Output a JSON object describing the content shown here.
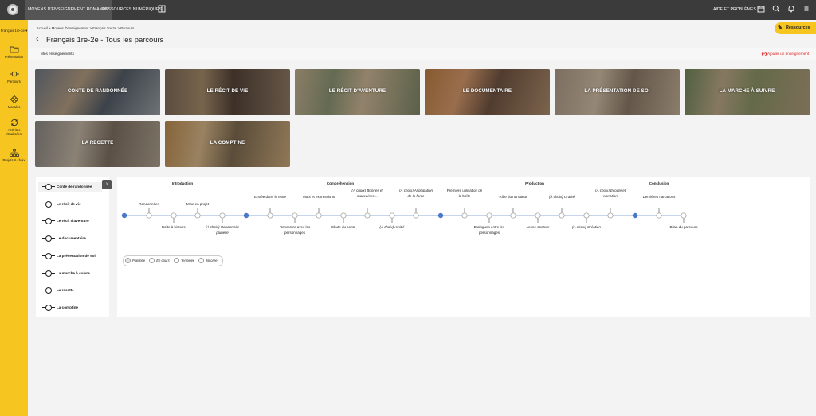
{
  "topbar": {
    "tab_moyens": "MOYENS D'ENSEIGNEMENT ROMANDS",
    "tab_ressources": "RESSOURCES NUMÉRIQUES",
    "help": "AIDE ET PROBLÈMES",
    "icons": [
      "book-icon",
      "calendar-icon",
      "search-icon",
      "bell-icon",
      "menu-icon"
    ]
  },
  "sidebar": {
    "class_selector": "Français 1re-2e",
    "items": [
      {
        "label": "Présentation",
        "icon": "folder-icon"
      },
      {
        "label": "Parcours",
        "icon": "path-icon"
      },
      {
        "label": "Modules",
        "icon": "modules-icon"
      },
      {
        "label": "Activités ritualisées",
        "icon": "cycle-icon"
      },
      {
        "label": "Projets & choix",
        "icon": "network-icon"
      }
    ]
  },
  "breadcrumb": "Accueil > Moyens d'enseignement > Français 1re-2e > Parcours",
  "page_title": "Français 1re-2e - Tous les parcours",
  "ressources_button": "Ressources",
  "mes_enseignements": "Mes enseignements",
  "add_enseignement": "Ajouter un enseignement",
  "cards": [
    {
      "label": "CONTE DE RANDONNÉE"
    },
    {
      "label": "LE RÉCIT DE VIE"
    },
    {
      "label": "LE RÉCIT D'AVENTURE"
    },
    {
      "label": "LE DOCUMENTAIRE"
    },
    {
      "label": "LA PRÉSENTATION DE SOI"
    },
    {
      "label": "LA MARCHE À SUIVRE"
    },
    {
      "label": "LA RECETTE"
    },
    {
      "label": "LA COMPTINE"
    }
  ],
  "paths": [
    "Conte de randonnée",
    "Le récit de vie",
    "Le récit d'aventure",
    "Le documentaire",
    "La présentation de soi",
    "La marche à suivre",
    "La recette",
    "La comptine"
  ],
  "timeline": {
    "sections": [
      "Introduction",
      "Compréhension",
      "Production",
      "Conclusion"
    ],
    "labels_above": [
      "Randonnées",
      "Mise en projet",
      "Entrée dans le texte",
      "Mots et expressions",
      "(À choix) Bonnes et mauvaises…",
      "(À choix) Anticipation de la force",
      "Première utilisation de la boîte",
      "Rôle du narrateur",
      "(À choix) Oralité",
      "(À choix) Écoute et narration",
      "Dernières narrations"
    ],
    "labels_below": [
      "Boîte à histoire",
      "(À choix) Randonnée plurielle",
      "Rencontre avec les personnages",
      "Chute du conte",
      "(À choix) Amitié",
      "Dialogues entre les personnages",
      "Jeune conteur",
      "(À choix) Création",
      "Bilan du parcours"
    ]
  },
  "legend": [
    "Planifiée",
    "En cours",
    "Terminée",
    "Ignorée"
  ]
}
